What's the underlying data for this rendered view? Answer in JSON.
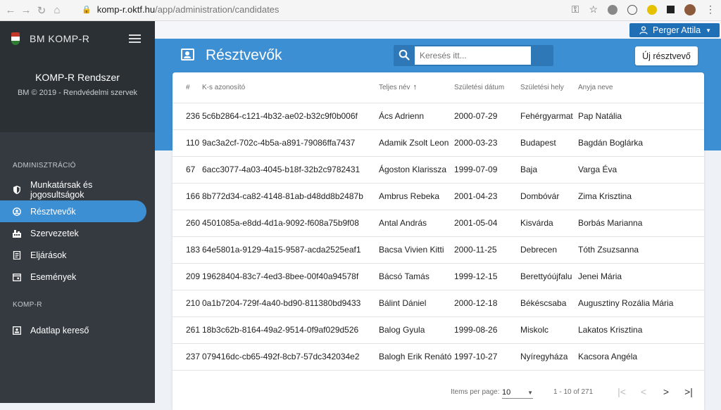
{
  "browser": {
    "url_host": "komp-r.oktf.hu",
    "url_path": "/app/administration/candidates"
  },
  "sidebar": {
    "brand": "BM KOMP-R",
    "system_title": "KOMP-R Rendszer",
    "system_subtitle": "BM © 2019 - Rendvédelmi szervek",
    "sections": [
      {
        "heading": "ADMINISZTRÁCIÓ",
        "items": [
          {
            "label": "Munkatársak és jogosultságok",
            "icon": "shield-icon"
          },
          {
            "label": "Résztvevők",
            "icon": "user-circle-icon",
            "active": true
          },
          {
            "label": "Szervezetek",
            "icon": "building-icon"
          },
          {
            "label": "Eljárások",
            "icon": "document-icon"
          },
          {
            "label": "Események",
            "icon": "calendar-icon"
          }
        ]
      },
      {
        "heading": "KOMP-R",
        "items": [
          {
            "label": "Adatlap kereső",
            "icon": "id-card-icon"
          }
        ]
      }
    ]
  },
  "header": {
    "user_name": "Perger Attila",
    "page_title": "Résztvevők",
    "search_placeholder": "Keresés itt...",
    "new_button": "Új résztvevő"
  },
  "table": {
    "columns": [
      "#",
      "K-s azonosító",
      "Teljes név",
      "Születési dátum",
      "Születési hely",
      "Anyja neve"
    ],
    "sort_column": "Teljes név",
    "rows": [
      [
        "236",
        "5c6b2864-c121-4b32-ae02-b32c9f0b006f",
        "Ács Adrienn",
        "2000-07-29",
        "Fehérgyarmat",
        "Pap Natália"
      ],
      [
        "110",
        "9ac3a2cf-702c-4b5a-a891-79086ffa7437",
        "Adamik Zsolt Leon",
        "2000-03-23",
        "Budapest",
        "Bagdán Boglárka"
      ],
      [
        "67",
        "6acc3077-4a03-4045-b18f-32b2c9782431",
        "Ágoston Klarissza",
        "1999-07-09",
        "Baja",
        "Varga Éva"
      ],
      [
        "166",
        "8b772d34-ca82-4148-81ab-d48dd8b2487b",
        "Ambrus Rebeka",
        "2001-04-23",
        "Dombóvár",
        "Zima Krisztina"
      ],
      [
        "260",
        "4501085a-e8dd-4d1a-9092-f608a75b9f08",
        "Antal András",
        "2001-05-04",
        "Kisvárda",
        "Borbás Marianna"
      ],
      [
        "183",
        "64e5801a-9129-4a15-9587-acda2525eaf1",
        "Bacsa Vivien Kitti",
        "2000-11-25",
        "Debrecen",
        "Tóth Zsuzsanna"
      ],
      [
        "209",
        "19628404-83c7-4ed3-8bee-00f40a94578f",
        "Bácsó Tamás",
        "1999-12-15",
        "Berettyóújfalu",
        "Jenei Mária"
      ],
      [
        "210",
        "0a1b7204-729f-4a40-bd90-811380bd9433",
        "Bálint Dániel",
        "2000-12-18",
        "Békéscsaba",
        "Augusztiny Rozália Mária"
      ],
      [
        "261",
        "18b3c62b-8164-49a2-9514-0f9af029d526",
        "Balog Gyula",
        "1999-08-26",
        "Miskolc",
        "Lakatos Krisztina"
      ],
      [
        "237",
        "079416dc-cb65-492f-8cb7-57dc342034e2",
        "Balogh Erik Renátó",
        "1997-10-27",
        "Nyíregyháza",
        "Kacsora Angéla"
      ]
    ]
  },
  "pagination": {
    "label": "Items per page:",
    "page_size": "10",
    "range": "1 - 10 of 271"
  },
  "colors": {
    "sidebar_bg": "#343a40",
    "accent": "#3d8fd4",
    "user_button": "#1f6fb7"
  }
}
